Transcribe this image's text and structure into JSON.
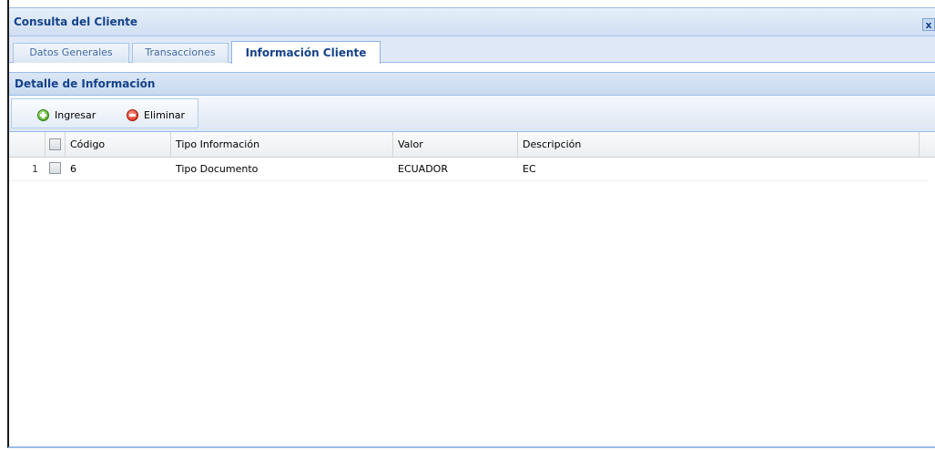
{
  "window": {
    "title": "Consulta del Cliente",
    "close_glyph": "x"
  },
  "tabs": [
    {
      "label": "Datos Generales",
      "active": false
    },
    {
      "label": "Transacciones",
      "active": false
    },
    {
      "label": "Información Cliente",
      "active": true
    }
  ],
  "panel": {
    "title": "Detalle de Información"
  },
  "toolbar": {
    "add_label": "Ingresar",
    "add_icon": "add-circle-icon",
    "delete_label": "Eliminar",
    "delete_icon": "remove-circle-icon"
  },
  "grid": {
    "columns": [
      "Código",
      "Tipo Información",
      "Valor",
      "Descripción"
    ],
    "rows": [
      {
        "number": "1",
        "codigo": "6",
        "tipo": "Tipo Documento",
        "valor": "ECUADOR",
        "descripcion": "EC"
      }
    ]
  },
  "colors": {
    "title_text": "#15428b",
    "border": "#99bbe8",
    "header_bg": "#dfe8f6"
  }
}
